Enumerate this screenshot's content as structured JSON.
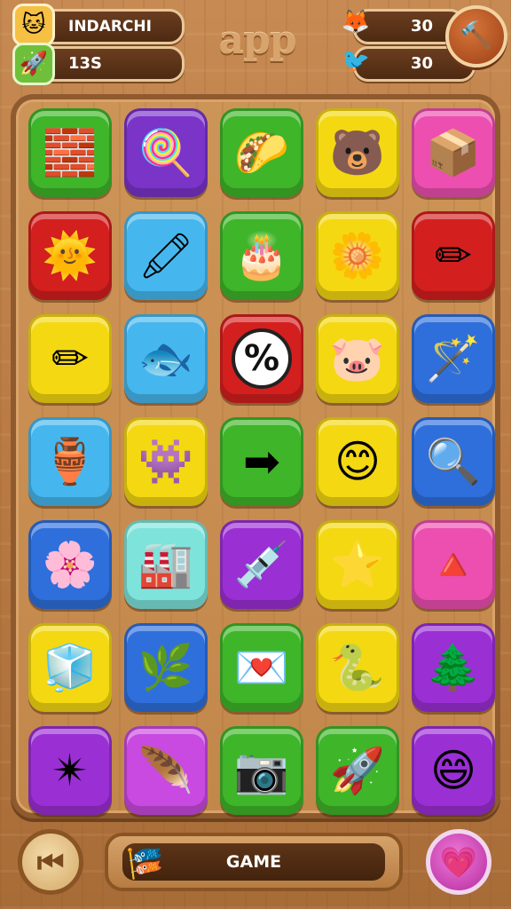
{
  "header": {
    "player_name": "INDARCHI",
    "score": "13S",
    "logo_text": "app",
    "counter_a": "30",
    "counter_b": "30",
    "player_avatar_icon": "cat-face-icon",
    "score_icon": "rocket-icon",
    "counter_a_icon": "fox-icon",
    "counter_b_icon": "bird-icon",
    "settings_icon": "hammer-icon"
  },
  "board": {
    "tiles": [
      {
        "color": "#3fb52a",
        "icon": "blocks-icon",
        "glyph": "🧱"
      },
      {
        "color": "#7a34c8",
        "icon": "lollipop-icon",
        "glyph": "🍭"
      },
      {
        "color": "#3fb52a",
        "icon": "taco-icon",
        "glyph": "🌮"
      },
      {
        "color": "#f4d812",
        "icon": "bear-face-icon",
        "glyph": "🐻"
      },
      {
        "color": "#ec4fb0",
        "icon": "paper-box-icon",
        "glyph": "📦"
      },
      {
        "color": "#d41f1f",
        "icon": "sun-face-icon",
        "glyph": "🌞"
      },
      {
        "color": "#46b7ee",
        "icon": "crayon-icon",
        "glyph": "🖍"
      },
      {
        "color": "#3fb52a",
        "icon": "cake-icon",
        "glyph": "🎂"
      },
      {
        "color": "#f4d812",
        "icon": "flower-icon",
        "glyph": "🌼"
      },
      {
        "color": "#d41f1f",
        "icon": "pencil-icon",
        "glyph": "✏"
      },
      {
        "color": "#f4d812",
        "icon": "pencil-icon",
        "glyph": "✏"
      },
      {
        "color": "#46b7ee",
        "icon": "fish-icon",
        "glyph": "🐟"
      },
      {
        "color": "#d41f1f",
        "icon": "percent-icon",
        "glyph": "%"
      },
      {
        "color": "#f4d812",
        "icon": "pig-icon",
        "glyph": "🐷"
      },
      {
        "color": "#2f6fdc",
        "icon": "magic-wand-icon",
        "glyph": "🪄"
      },
      {
        "color": "#46b7ee",
        "icon": "jar-icon",
        "glyph": "🏺"
      },
      {
        "color": "#f4d812",
        "icon": "jelly-monster-icon",
        "glyph": "👾"
      },
      {
        "color": "#3fb52a",
        "icon": "arrow-right-icon",
        "glyph": "➡"
      },
      {
        "color": "#f4d812",
        "icon": "smiley-face-icon",
        "glyph": "😊"
      },
      {
        "color": "#2f6fdc",
        "icon": "magnifier-icon",
        "glyph": "🔍"
      },
      {
        "color": "#2f6fdc",
        "icon": "flower-face-icon",
        "glyph": "🌸"
      },
      {
        "color": "#7ee3db",
        "icon": "factory-icon",
        "glyph": "🏭"
      },
      {
        "color": "#9a2fd4",
        "icon": "syringe-icon",
        "glyph": "💉"
      },
      {
        "color": "#f4d812",
        "icon": "star-face-icon",
        "glyph": "⭐"
      },
      {
        "color": "#ec4fb0",
        "icon": "pennant-icon",
        "glyph": "🔺"
      },
      {
        "color": "#f4d812",
        "icon": "ice-pop-icon",
        "glyph": "🧊"
      },
      {
        "color": "#2f6fdc",
        "icon": "leaf-plant-icon",
        "glyph": "🌿"
      },
      {
        "color": "#3fb52a",
        "icon": "heart-card-icon",
        "glyph": "💌"
      },
      {
        "color": "#f4d812",
        "icon": "snake-icon",
        "glyph": "🐍"
      },
      {
        "color": "#9a2fd4",
        "icon": "arrow-tree-icon",
        "glyph": "🌲"
      },
      {
        "color": "#9a2fd4",
        "icon": "gear-star-icon",
        "glyph": "✴"
      },
      {
        "color": "#c84ae0",
        "icon": "feather-icon",
        "glyph": "🪶"
      },
      {
        "color": "#3fb52a",
        "icon": "camera-icon",
        "glyph": "📷"
      },
      {
        "color": "#3fb52a",
        "icon": "rocket-icon",
        "glyph": "🚀"
      },
      {
        "color": "#9a2fd4",
        "icon": "happy-face-icon",
        "glyph": "😄"
      }
    ]
  },
  "footer": {
    "back_icon": "back-icon",
    "game_label": "GAME",
    "game_icon": "windmill-icon",
    "favorite_icon": "heart-icon"
  }
}
